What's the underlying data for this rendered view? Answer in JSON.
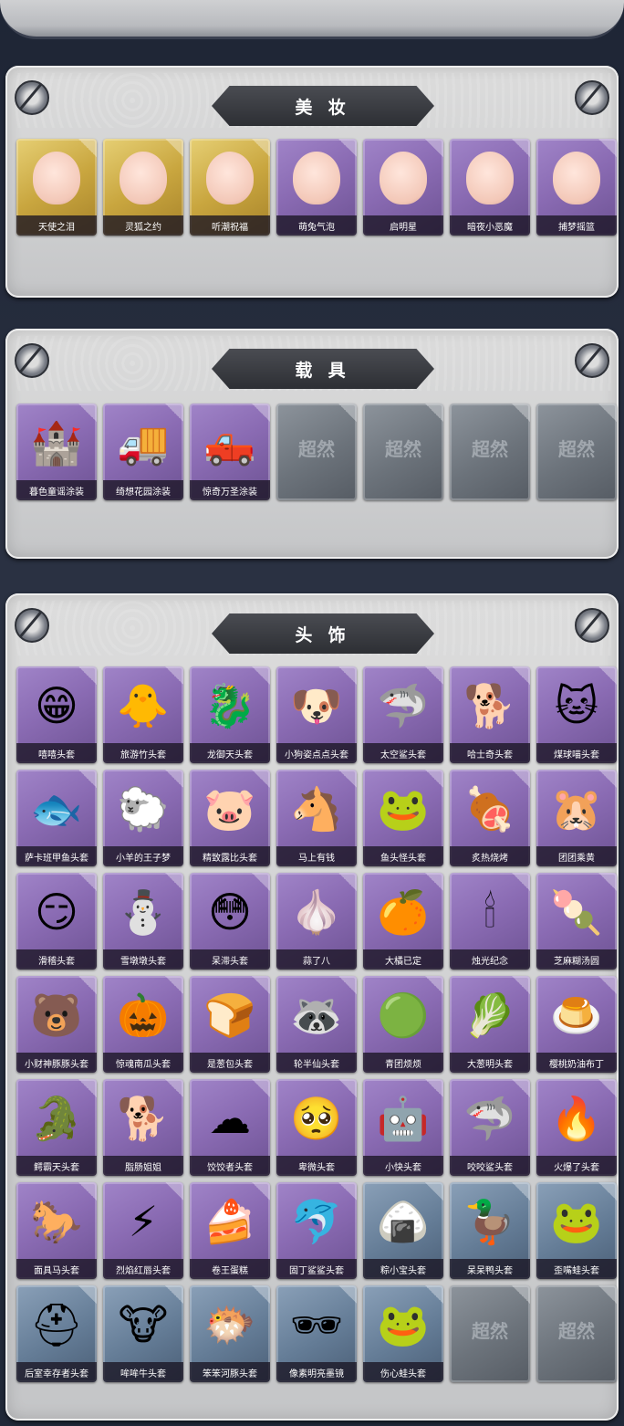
{
  "sections": [
    {
      "title": "美 妆",
      "items": [
        {
          "label": "天使之泪",
          "icon": "angel-wings-face-icon",
          "glyph": "",
          "style": "gold"
        },
        {
          "label": "灵狐之约",
          "icon": "fox-ears-face-icon",
          "glyph": "",
          "style": "gold"
        },
        {
          "label": "听潮祝福",
          "icon": "fin-ears-face-icon",
          "glyph": "",
          "style": "gold"
        },
        {
          "label": "萌兔气泡",
          "icon": "bunny-bubble-face-icon",
          "glyph": "",
          "style": "purple"
        },
        {
          "label": "启明星",
          "icon": "star-glasses-face-icon",
          "glyph": "",
          "style": "purple"
        },
        {
          "label": "暗夜小恶魔",
          "icon": "devil-horns-face-icon",
          "glyph": "",
          "style": "purple"
        },
        {
          "label": "捕梦摇篮",
          "icon": "dream-flower-face-icon",
          "glyph": "",
          "style": "purple"
        }
      ]
    },
    {
      "title": "载 具",
      "items": [
        {
          "label": "暮色童谣涂装",
          "icon": "castle-carriage-icon",
          "glyph": "🏰",
          "style": "purple"
        },
        {
          "label": "绮想花园涂装",
          "icon": "garden-truck-icon",
          "glyph": "🚚",
          "style": "purple"
        },
        {
          "label": "惊奇万圣涂装",
          "icon": "halloween-truck-icon",
          "glyph": "🛻",
          "style": "purple"
        },
        {
          "label": "",
          "icon": "empty-slot-icon",
          "glyph": "超然",
          "style": "empty"
        },
        {
          "label": "",
          "icon": "empty-slot-icon",
          "glyph": "超然",
          "style": "empty"
        },
        {
          "label": "",
          "icon": "empty-slot-icon",
          "glyph": "超然",
          "style": "empty"
        },
        {
          "label": "",
          "icon": "empty-slot-icon",
          "glyph": "超然",
          "style": "empty"
        }
      ]
    },
    {
      "title": "头 饰",
      "items": [
        {
          "label": "嘻嘻头套",
          "icon": "grin-emoji-icon",
          "glyph": "😁",
          "style": "purple"
        },
        {
          "label": "旅游竹头套",
          "icon": "duck-hat-icon",
          "glyph": "🐥",
          "style": "purple"
        },
        {
          "label": "龙御天头套",
          "icon": "dragon-head-icon",
          "glyph": "🐉",
          "style": "purple"
        },
        {
          "label": "小狗姿点点头套",
          "icon": "dog-head-icon",
          "glyph": "🐶",
          "style": "purple"
        },
        {
          "label": "太空鲨头套",
          "icon": "shark-head-icon",
          "glyph": "🦈",
          "style": "purple"
        },
        {
          "label": "哈士奇头套",
          "icon": "husky-head-icon",
          "glyph": "🐕",
          "style": "purple"
        },
        {
          "label": "煤球喵头套",
          "icon": "cat-head-icon",
          "glyph": "🐱",
          "style": "purple"
        },
        {
          "label": "萨卡班甲鱼头套",
          "icon": "fish-head-icon",
          "glyph": "🐟",
          "style": "purple"
        },
        {
          "label": "小羊的王子梦",
          "icon": "sheep-crown-icon",
          "glyph": "🐑",
          "style": "purple"
        },
        {
          "label": "精致露比头套",
          "icon": "pink-beaver-icon",
          "glyph": "🐷",
          "style": "purple"
        },
        {
          "label": "马上有钱",
          "icon": "horse-head-icon",
          "glyph": "🐴",
          "style": "purple"
        },
        {
          "label": "鱼头怪头套",
          "icon": "fish-monster-icon",
          "glyph": "🐸",
          "style": "purple"
        },
        {
          "label": "炙热烧烤",
          "icon": "bbq-meat-icon",
          "glyph": "🍖",
          "style": "purple"
        },
        {
          "label": "团团乘黄",
          "icon": "bun-cat-icon",
          "glyph": "🐹",
          "style": "purple"
        },
        {
          "label": "滑稽头套",
          "icon": "smirk-emoji-icon",
          "glyph": "😏",
          "style": "purple"
        },
        {
          "label": "雪墩墩头套",
          "icon": "snowman-head-icon",
          "glyph": "⛄",
          "style": "purple"
        },
        {
          "label": "呆滞头套",
          "icon": "stare-emoji-icon",
          "glyph": "😳",
          "style": "purple"
        },
        {
          "label": "蒜了八",
          "icon": "garlic-head-icon",
          "glyph": "🧄",
          "style": "purple"
        },
        {
          "label": "大橘已定",
          "icon": "orange-head-icon",
          "glyph": "🍊",
          "style": "purple"
        },
        {
          "label": "烛光纪念",
          "icon": "candle-head-icon",
          "glyph": "🕯",
          "style": "purple"
        },
        {
          "label": "芝麻糊汤圆",
          "icon": "dumpling-head-icon",
          "glyph": "🍡",
          "style": "purple"
        },
        {
          "label": "小财神豚豚头套",
          "icon": "capybara-head-icon",
          "glyph": "🐻",
          "style": "purple"
        },
        {
          "label": "惊魂南瓜头套",
          "icon": "pumpkin-head-icon",
          "glyph": "🎃",
          "style": "purple"
        },
        {
          "label": "是葱包头套",
          "icon": "bun-head-icon",
          "glyph": "🍞",
          "style": "purple"
        },
        {
          "label": "轮半仙头套",
          "icon": "raccoon-head-icon",
          "glyph": "🦝",
          "style": "purple"
        },
        {
          "label": "青团烦烦",
          "icon": "green-bun-icon",
          "glyph": "🟢",
          "style": "purple"
        },
        {
          "label": "大葱明头套",
          "icon": "scallion-head-icon",
          "glyph": "🥬",
          "style": "purple"
        },
        {
          "label": "樱桃奶油布丁",
          "icon": "pudding-head-icon",
          "glyph": "🍮",
          "style": "purple"
        },
        {
          "label": "鳄霸天头套",
          "icon": "crocodile-head-icon",
          "glyph": "🐊",
          "style": "purple"
        },
        {
          "label": "脂肠姐姐",
          "icon": "sausage-dog-icon",
          "glyph": "🐕",
          "style": "purple"
        },
        {
          "label": "饺饺者头套",
          "icon": "cloud-head-icon",
          "glyph": "☁",
          "style": "purple"
        },
        {
          "label": "卑微头套",
          "icon": "humble-emoji-icon",
          "glyph": "🥺",
          "style": "purple"
        },
        {
          "label": "小快头套",
          "icon": "robot-head-icon",
          "glyph": "🤖",
          "style": "purple"
        },
        {
          "label": "咬咬鲨头套",
          "icon": "biting-shark-icon",
          "glyph": "🦈",
          "style": "purple"
        },
        {
          "label": "火爆了头套",
          "icon": "fire-head-icon",
          "glyph": "🔥",
          "style": "purple"
        },
        {
          "label": "面具马头套",
          "icon": "horse-mask-icon",
          "glyph": "🐎",
          "style": "purple"
        },
        {
          "label": "烈焰红唇头套",
          "icon": "pikachu-lips-icon",
          "glyph": "⚡",
          "style": "purple"
        },
        {
          "label": "卷王蛋糕",
          "icon": "roll-cake-icon",
          "glyph": "🍰",
          "style": "purple"
        },
        {
          "label": "固丁鲨鲨头套",
          "icon": "blue-shark-icon",
          "glyph": "🐬",
          "style": "purple"
        },
        {
          "label": "粽小宝头套",
          "icon": "zongzi-head-icon",
          "glyph": "🍙",
          "style": "blue"
        },
        {
          "label": "呆呆鸭头套",
          "icon": "duck-head-icon",
          "glyph": "🦆",
          "style": "blue"
        },
        {
          "label": "歪嘴蛙头套",
          "icon": "frog-head-icon",
          "glyph": "🐸",
          "style": "blue"
        },
        {
          "label": "后室幸存者头套",
          "icon": "hazmat-helmet-icon",
          "glyph": "⛑",
          "style": "blue"
        },
        {
          "label": "哞哞牛头套",
          "icon": "cow-head-icon",
          "glyph": "🐮",
          "style": "blue"
        },
        {
          "label": "笨笨河豚头套",
          "icon": "pufferfish-head-icon",
          "glyph": "🐡",
          "style": "blue"
        },
        {
          "label": "像素明亮墨镜",
          "icon": "pixel-sunglasses-icon",
          "glyph": "🕶",
          "style": "blue"
        },
        {
          "label": "伤心蛙头套",
          "icon": "sad-frog-icon",
          "glyph": "🐸",
          "style": "blue"
        },
        {
          "label": "",
          "icon": "empty-slot-icon",
          "glyph": "超然",
          "style": "empty"
        },
        {
          "label": "",
          "icon": "empty-slot-icon",
          "glyph": "超然",
          "style": "empty"
        }
      ]
    }
  ]
}
